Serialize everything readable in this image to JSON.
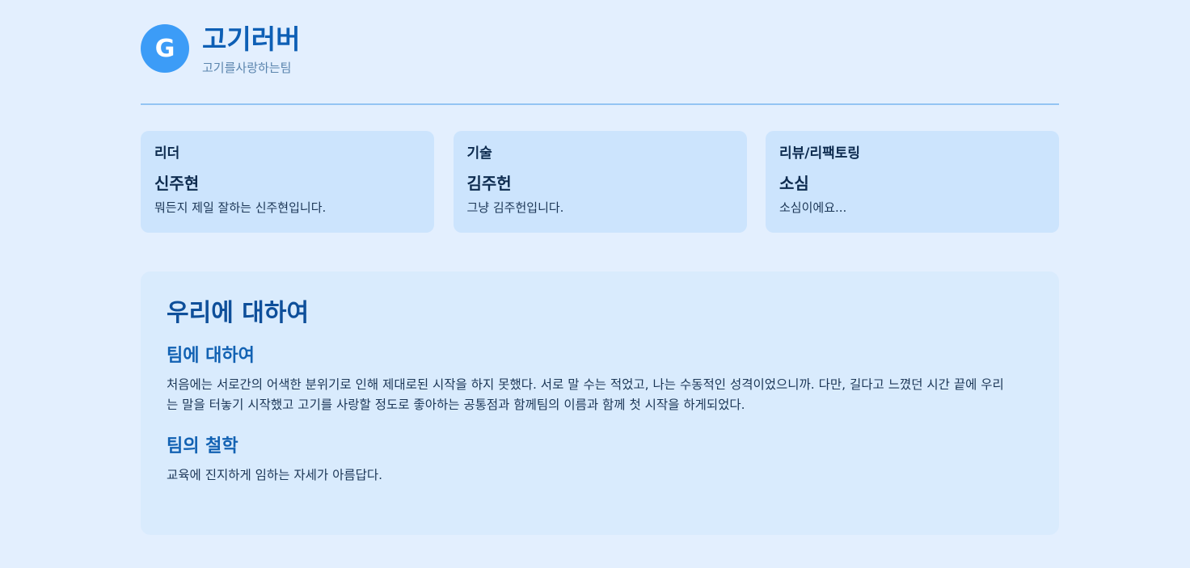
{
  "header": {
    "logo_letter": "G",
    "team_name": "고기러버",
    "tagline": "고기를사랑하는팀"
  },
  "members": [
    {
      "role": "리더",
      "name": "신주현",
      "desc": "뭐든지 제일 잘하는 신주현입니다."
    },
    {
      "role": "기술",
      "name": "김주헌",
      "desc": "그냥 김주헌입니다."
    },
    {
      "role": "리뷰/리팩토링",
      "name": "소심",
      "desc": "소심이에요..."
    }
  ],
  "about": {
    "title": "우리에 대하여",
    "sections": [
      {
        "title": "팀에 대하여",
        "body": "처음에는 서로간의 어색한 분위기로 인해 제대로된 시작을 하지 못했다. 서로 말 수는 적었고, 나는 수동적인 성격이었으니까. 다만, 길다고 느꼈던 시간 끝에 우리는 말을 터놓기 시작했고 고기를 사랑할 정도로 좋아하는 공통점과 함께팀의 이름과 함께 첫 시작을 하게되었다."
      },
      {
        "title": "팀의 철학",
        "body": "교육에 진지하게 임하는 자세가 아름답다."
      }
    ]
  },
  "colors": {
    "page_bg": "#e3effe",
    "logo_bg": "#3c9cf7",
    "brand_blue": "#0e5fb5",
    "card_bg": "#cce4fd",
    "about_bg": "#d9ebfd",
    "divider": "#93c4f3"
  }
}
